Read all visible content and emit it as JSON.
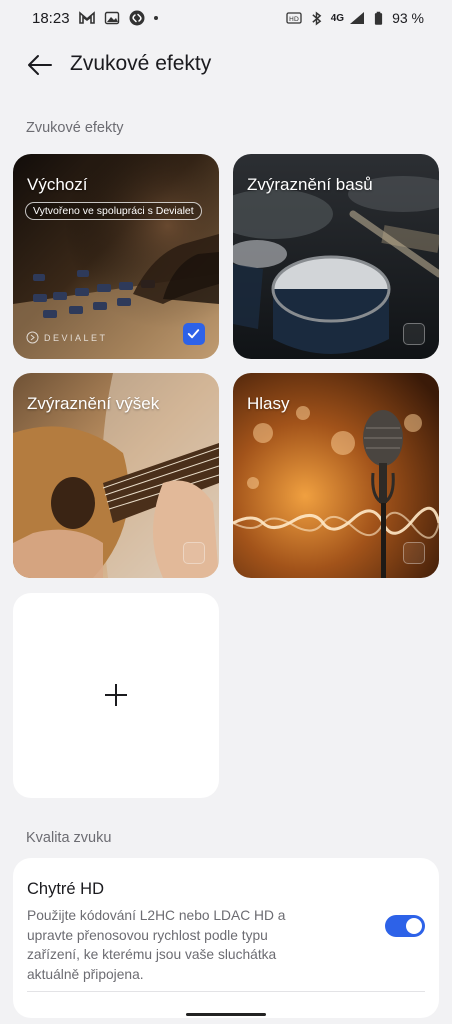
{
  "status_bar": {
    "time": "18:23",
    "network": "4G",
    "battery": "93 %",
    "left_icons": [
      "gmail-icon",
      "gallery-icon",
      "shazam-icon",
      "dot-icon"
    ],
    "right_icons": [
      "hd-icon",
      "bluetooth-icon",
      "signal-icon",
      "battery-icon"
    ]
  },
  "header": {
    "title": "Zvukové efekty",
    "back_icon": "arrow-left-icon"
  },
  "effects_section": {
    "label": "Zvukové efekty",
    "cards": [
      {
        "label": "Výchozí",
        "badge": "Vytvořeno ve spolupráci s Devialet",
        "brand": "DEVIALET",
        "selected": true
      },
      {
        "label": "Zvýraznění basů",
        "selected": false
      },
      {
        "label": "Zvýraznění výšek",
        "selected": false
      },
      {
        "label": "Hlasy",
        "selected": false
      }
    ],
    "add_icon": "plus-icon"
  },
  "quality_section": {
    "label": "Kvalita zvuku",
    "smart_hd": {
      "title": "Chytré HD",
      "description": "Použijte kódování L2HC nebo LDAC HD a upravte přenosovou rychlost podle typu zařízení, ke kterému jsou vaše sluchátka aktuálně připojena.",
      "enabled": true
    }
  },
  "colors": {
    "accent": "#2d62e8",
    "background": "#f2f2f4",
    "card": "#ffffff",
    "secondary_text": "#6c6c72"
  }
}
